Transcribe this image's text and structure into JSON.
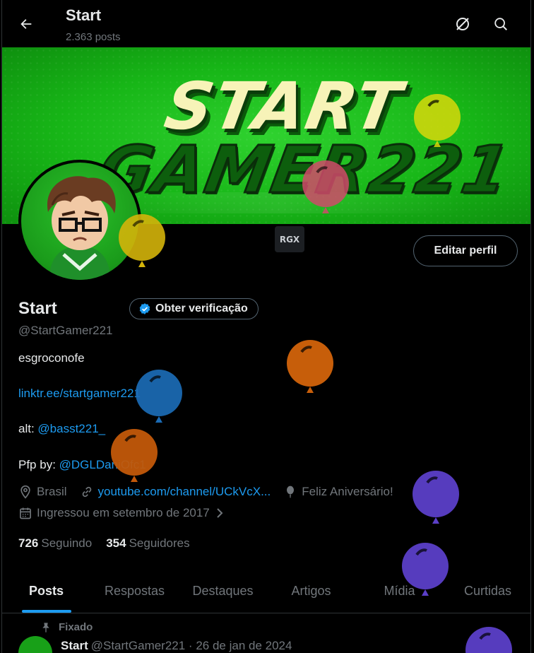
{
  "header": {
    "title": "Start",
    "post_count": "2.363 posts"
  },
  "banner": {
    "line1": "START",
    "line2": "GAMER221"
  },
  "profile": {
    "badge_text": "RGX",
    "edit_button": "Editar perfil",
    "name": "Start",
    "verify_button": "Obter verificação",
    "handle": "@StartGamer221",
    "bio_line1": "esgroconofe",
    "bio_link": "linktr.ee/startgamer221",
    "alt_label": "alt: ",
    "alt_handle": "@basst221_",
    "pfp_label": "Pfp by: ",
    "pfp_handle": "@DGLDaniOfc1",
    "location": "Brasil",
    "website": "youtube.com/channel/UCkVcX...",
    "birthday": "Feliz Aniversário!",
    "joined": "Ingressou em setembro de 2017",
    "following_count": "726",
    "following_label": "Seguindo",
    "followers_count": "354",
    "followers_label": "Seguidores"
  },
  "tabs": [
    {
      "label": "Posts"
    },
    {
      "label": "Respostas"
    },
    {
      "label": "Destaques"
    },
    {
      "label": "Artigos"
    },
    {
      "label": "Mídia"
    },
    {
      "label": "Curtidas"
    }
  ],
  "pinned_post": {
    "pinned_label": "Fixado",
    "author": "Start",
    "meta": "@StartGamer221 · 26 de jan de 2024"
  },
  "colors": {
    "accent": "#1d9bf0",
    "muted": "#71767b",
    "banner_green": "#22c322"
  },
  "icons": [
    "back-arrow-icon",
    "grok-icon",
    "search-icon",
    "verified-badge-icon",
    "location-icon",
    "link-icon",
    "balloon-icon",
    "calendar-icon",
    "chevron-right-icon",
    "pin-icon"
  ]
}
